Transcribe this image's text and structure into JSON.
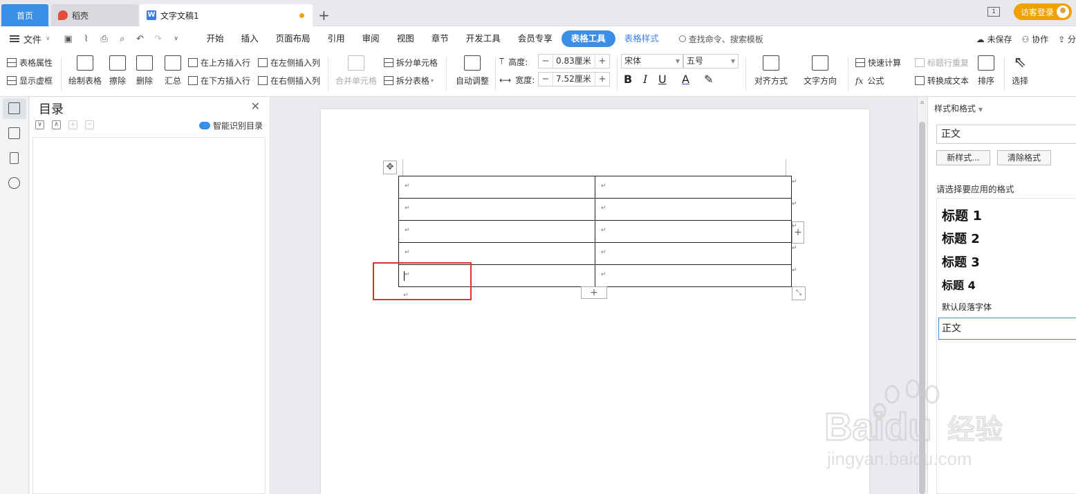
{
  "tabs": {
    "home": "首页",
    "straw": "稻壳",
    "doc": "文字文稿1",
    "add": "+"
  },
  "titlebar": {
    "login": "访客登录"
  },
  "menu": {
    "file": "文件",
    "items": [
      "开始",
      "插入",
      "页面布局",
      "引用",
      "审阅",
      "视图",
      "章节",
      "开发工具",
      "会员专享",
      "表格工具",
      "表格样式"
    ],
    "search": "查找命令、搜索模板",
    "unsaved": "未保存",
    "collab": "协作",
    "share": "分"
  },
  "ribbon": {
    "table_props": "表格属性",
    "show_grid": "显示虚框",
    "draw_table": "绘制表格",
    "erase": "擦除",
    "delete": "删除",
    "summary": "汇总",
    "insert_above": "在上方插入行",
    "insert_below": "在下方插入行",
    "insert_left": "在左侧插入列",
    "insert_right": "在右侧插入列",
    "merge_cells": "合并单元格",
    "split_cells": "拆分单元格",
    "split_table": "拆分表格",
    "auto_fit": "自动调整",
    "height_label": "高度:",
    "height_value": "0.83厘米",
    "width_label": "宽度:",
    "width_value": "7.52厘米",
    "font_name": "宋体",
    "font_size": "五号",
    "align": "对齐方式",
    "text_dir": "文字方向",
    "quick_calc": "快速计算",
    "formula": "公式",
    "repeat_header": "标题行重复",
    "to_text": "转换成文本",
    "sort": "排序",
    "select": "选择"
  },
  "toc": {
    "title": "目录",
    "smart": "智能识别目录"
  },
  "document": {
    "rows": 5,
    "cols": 2,
    "para_mark": "↵"
  },
  "styles_panel": {
    "title": "样式和格式",
    "current": "正文",
    "new_style": "新样式...",
    "clear_format": "清除格式",
    "apply_label": "请选择要应用的格式",
    "styles": [
      "标题 1",
      "标题 2",
      "标题 3",
      "标题 4"
    ],
    "default_font": "默认段落字体",
    "normal": "正文"
  },
  "watermark": {
    "brand": "Baidu",
    "suffix": "经验",
    "url": "jingyan.baidu.com"
  },
  "colors": {
    "accent": "#3a8ee6",
    "highlight": "#e03030",
    "watermark": "#c8c8c8"
  }
}
